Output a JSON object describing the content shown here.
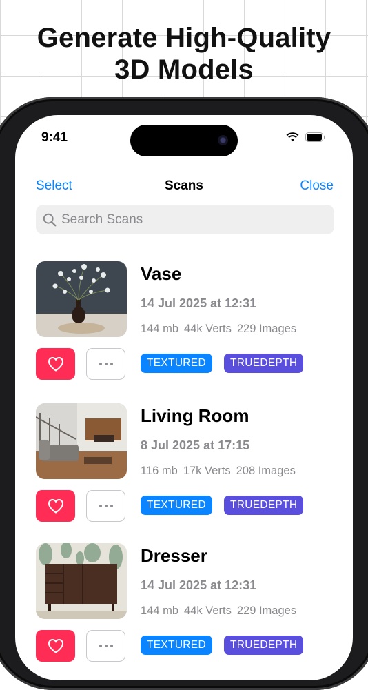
{
  "headline": {
    "line1": "Generate High-Quality",
    "line2": "3D Models"
  },
  "status_bar": {
    "time": "9:41"
  },
  "nav": {
    "left": "Select",
    "title": "Scans",
    "right": "Close"
  },
  "search": {
    "placeholder": "Search Scans",
    "value": ""
  },
  "scans": [
    {
      "title": "Vase",
      "date": "14 Jul 2025 at 12:31",
      "size": "144 mb",
      "verts": "44k Verts",
      "images": "229 Images",
      "tags": [
        "TEXTURED",
        "TRUEDEPTH"
      ],
      "favorite": true
    },
    {
      "title": "Living Room",
      "date": "8 Jul 2025 at 17:15",
      "size": "116 mb",
      "verts": "17k Verts",
      "images": "208 Images",
      "tags": [
        "TEXTURED",
        "TRUEDEPTH"
      ],
      "favorite": true
    },
    {
      "title": "Dresser",
      "date": "14 Jul 2025 at 12:31",
      "size": "144 mb",
      "verts": "44k Verts",
      "images": "229 Images",
      "tags": [
        "TEXTURED",
        "TRUEDEPTH"
      ],
      "favorite": true
    }
  ],
  "icons": [
    "search-icon",
    "wifi-icon",
    "battery-icon",
    "heart-icon",
    "ellipsis-icon"
  ],
  "colors": {
    "accent": "#0a84ff",
    "favorite": "#ff2d55",
    "truedepth": "#5a4fdc",
    "textured": "#0a84ff"
  }
}
